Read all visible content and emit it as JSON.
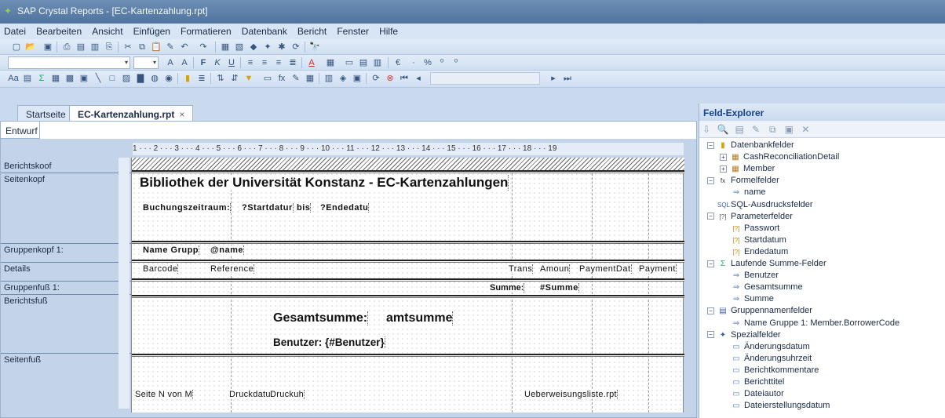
{
  "window": {
    "title": "SAP Crystal Reports - [EC-Kartenzahlung.rpt]"
  },
  "menu": [
    "Datei",
    "Bearbeiten",
    "Ansicht",
    "Einfügen",
    "Formatieren",
    "Datenbank",
    "Bericht",
    "Fenster",
    "Hilfe"
  ],
  "tabs": {
    "home": "Startseite",
    "doc": "EC-Kartenzahlung.rpt",
    "close": "×",
    "design": "Entwurf"
  },
  "ruler": "1 · · · 2 · · · 3 · · · 4 · · · 5 · · · 6 · · · 7 · · · 8 · · · 9 · · · 10 · · · 11 · · · 12 · · · 13 · · · 14 · · · 15 · · · 16 · · · 17 · · · 18 · · · 19",
  "sections": {
    "report_header": "Berichtskoof",
    "page_header": "Seitenkopf",
    "group_header": "Gruppenkopf 1:",
    "details": "Details",
    "group_footer": "Gruppenfuß 1:",
    "report_footer": "Berichtsfuß",
    "page_footer": "Seitenfuß"
  },
  "report": {
    "title": "Bibliothek der Universität Konstanz - EC-Kartenzahlungen",
    "period_label": "Buchungszeitraum:",
    "start": "?Startdatur",
    "bis": "bis",
    "end": "?Endedatu",
    "group_label": "Name Grupp",
    "group_value": "@name",
    "col_barcode": "Barcode",
    "col_reference": "Reference",
    "col_trans": "Trans",
    "col_amount": "Amoun",
    "col_paymentdate": "PaymentDat",
    "col_payment": "Payment",
    "sum_label": "Summe:",
    "sum_value": "#Summe",
    "grand_total": "Gesamtsumme:",
    "grand_total_value": "amtsumme",
    "user_line": "Benutzer: {#Benutzer}",
    "page_n": "Seite N von M",
    "print_date": "Druckdatur",
    "print_time": "Druckuh",
    "filename": "Ueberweisungsliste.rpt"
  },
  "explorer": {
    "title": "Feld-Explorer",
    "items": [
      {
        "label": "Datenbankfelder",
        "level": 0,
        "toggle": "−",
        "icon": "database-icon"
      },
      {
        "label": "CashReconciliationDetail",
        "level": 1,
        "toggle": "+",
        "icon": "table-icon"
      },
      {
        "label": "Member",
        "level": 1,
        "toggle": "+",
        "icon": "table-icon"
      },
      {
        "label": "Formelfelder",
        "level": 0,
        "toggle": "−",
        "icon": "formula-icon"
      },
      {
        "label": "name",
        "level": 1,
        "toggle": "",
        "icon": "field-icon"
      },
      {
        "label": "SQL-Ausdrucksfelder",
        "level": 0,
        "toggle": "",
        "icon": "sql-icon"
      },
      {
        "label": "Parameterfelder",
        "level": 0,
        "toggle": "−",
        "icon": "parameter-icon"
      },
      {
        "label": "Passwort",
        "level": 1,
        "toggle": "",
        "icon": "param-item-icon"
      },
      {
        "label": "Startdatum",
        "level": 1,
        "toggle": "",
        "icon": "param-item-icon"
      },
      {
        "label": "Endedatum",
        "level": 1,
        "toggle": "",
        "icon": "param-item-icon"
      },
      {
        "label": "Laufende Summe-Felder",
        "level": 0,
        "toggle": "−",
        "icon": "sum-icon"
      },
      {
        "label": "Benutzer",
        "level": 1,
        "toggle": "",
        "icon": "field-icon"
      },
      {
        "label": "Gesamtsumme",
        "level": 1,
        "toggle": "",
        "icon": "field-icon"
      },
      {
        "label": "Summe",
        "level": 1,
        "toggle": "",
        "icon": "field-icon"
      },
      {
        "label": "Gruppennamenfelder",
        "level": 0,
        "toggle": "−",
        "icon": "group-icon"
      },
      {
        "label": "Name Gruppe 1: Member.BorrowerCode",
        "level": 1,
        "toggle": "",
        "icon": "field-icon"
      },
      {
        "label": "Spezialfelder",
        "level": 0,
        "toggle": "−",
        "icon": "special-icon"
      },
      {
        "label": "Änderungsdatum",
        "level": 1,
        "toggle": "",
        "icon": "special-field-icon"
      },
      {
        "label": "Änderungsuhrzeit",
        "level": 1,
        "toggle": "",
        "icon": "special-field-icon"
      },
      {
        "label": "Berichtkommentare",
        "level": 1,
        "toggle": "",
        "icon": "special-field-icon"
      },
      {
        "label": "Berichttitel",
        "level": 1,
        "toggle": "",
        "icon": "special-field-icon"
      },
      {
        "label": "Dateiautor",
        "level": 1,
        "toggle": "",
        "icon": "special-field-icon"
      },
      {
        "label": "Dateierstellungsdatum",
        "level": 1,
        "toggle": "",
        "icon": "special-field-icon"
      }
    ]
  }
}
